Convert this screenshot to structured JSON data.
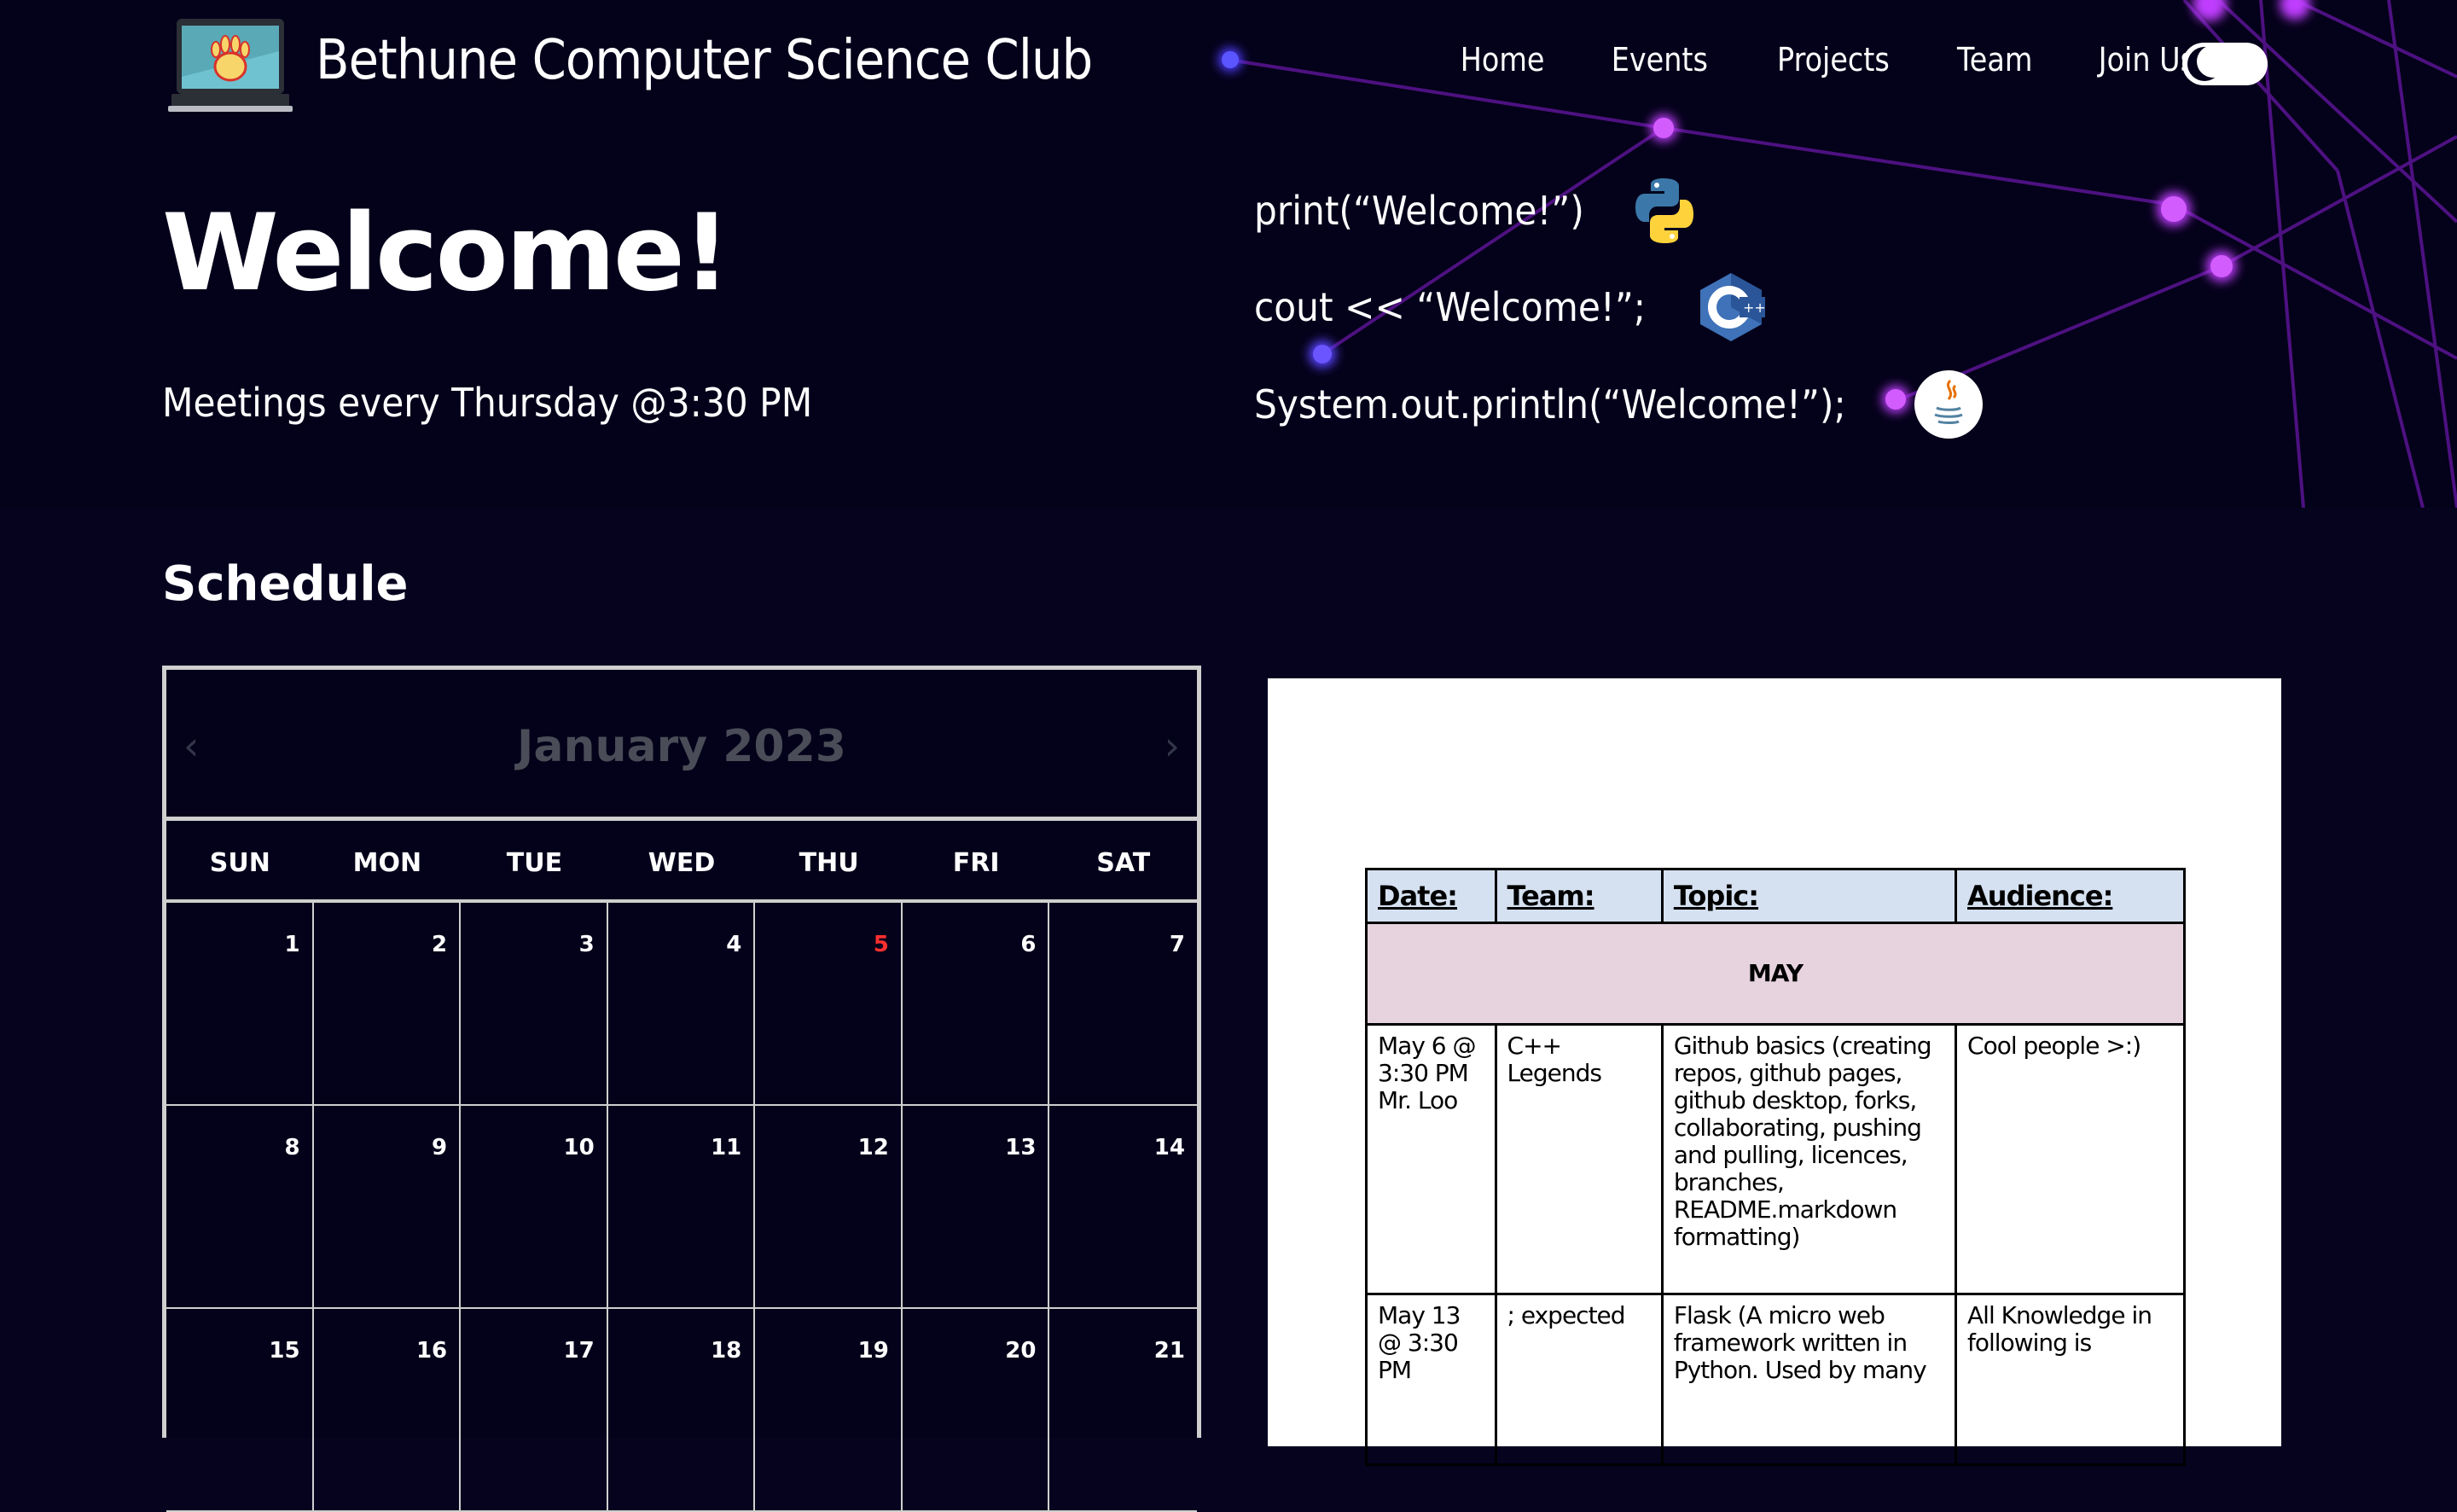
{
  "header": {
    "title": "Bethune Computer Science Club",
    "nav": [
      "Home",
      "Events",
      "Projects",
      "Team",
      "Join Us"
    ],
    "theme_toggle": "dark-mode-toggle"
  },
  "hero": {
    "heading": "Welcome!",
    "meetings": "Meetings every Thursday @3:30 PM",
    "code_lines": [
      {
        "text": "print(“Welcome!”)",
        "icon": "python-icon"
      },
      {
        "text": "cout << “Welcome!”;",
        "icon": "cpp-icon"
      },
      {
        "text": "System.out.println(“Welcome!”);",
        "icon": "java-icon"
      }
    ]
  },
  "schedule": {
    "heading": "Schedule",
    "calendar": {
      "month": "January 2023",
      "prev": "‹",
      "next": "›",
      "weekdays": [
        "SUN",
        "MON",
        "TUE",
        "WED",
        "THU",
        "FRI",
        "SAT"
      ],
      "days": [
        "1",
        "2",
        "3",
        "4",
        "5",
        "6",
        "7",
        "8",
        "9",
        "10",
        "11",
        "12",
        "13",
        "14",
        "15",
        "16",
        "17",
        "18",
        "19",
        "20",
        "21"
      ],
      "highlighted_day": "5",
      "highlight_color": "#ff3030"
    },
    "table": {
      "headers": [
        "Date:",
        "Team:",
        "Topic:",
        "Audience:"
      ],
      "month_label": "MAY",
      "rows": [
        [
          "May 6 @ 3:30 PM Mr. Loo",
          "C++ Legends",
          "Github basics (creating repos, github pages, github desktop, forks, collaborating, pushing and pulling, licences, branches, README.markdown formatting)",
          "Cool people >:)"
        ],
        [
          "May 13 @ 3:30 PM",
          "; expected",
          "Flask (A micro web framework written in Python. Used by many",
          "All Knowledge in following is"
        ]
      ]
    }
  }
}
